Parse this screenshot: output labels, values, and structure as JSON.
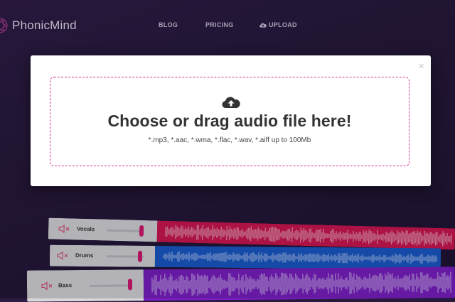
{
  "brand": {
    "name": "PhonicMind"
  },
  "nav": {
    "blog": "BLOG",
    "pricing": "PRICING",
    "upload": "UPLOAD"
  },
  "modal": {
    "close_symbol": "×",
    "title": "Choose or drag audio file here!",
    "formats": "*.mp3, *.aac, *.wma, *.flac, *.wav, *.aiff up to 100Mb"
  },
  "tracks": [
    {
      "name": "Vocals",
      "color": "#d0154f"
    },
    {
      "name": "Drums",
      "color": "#1859c9"
    },
    {
      "name": "Bass",
      "color": "#7a1fc2"
    }
  ],
  "colors": {
    "accent": "#d6186e",
    "background": "#251838"
  }
}
